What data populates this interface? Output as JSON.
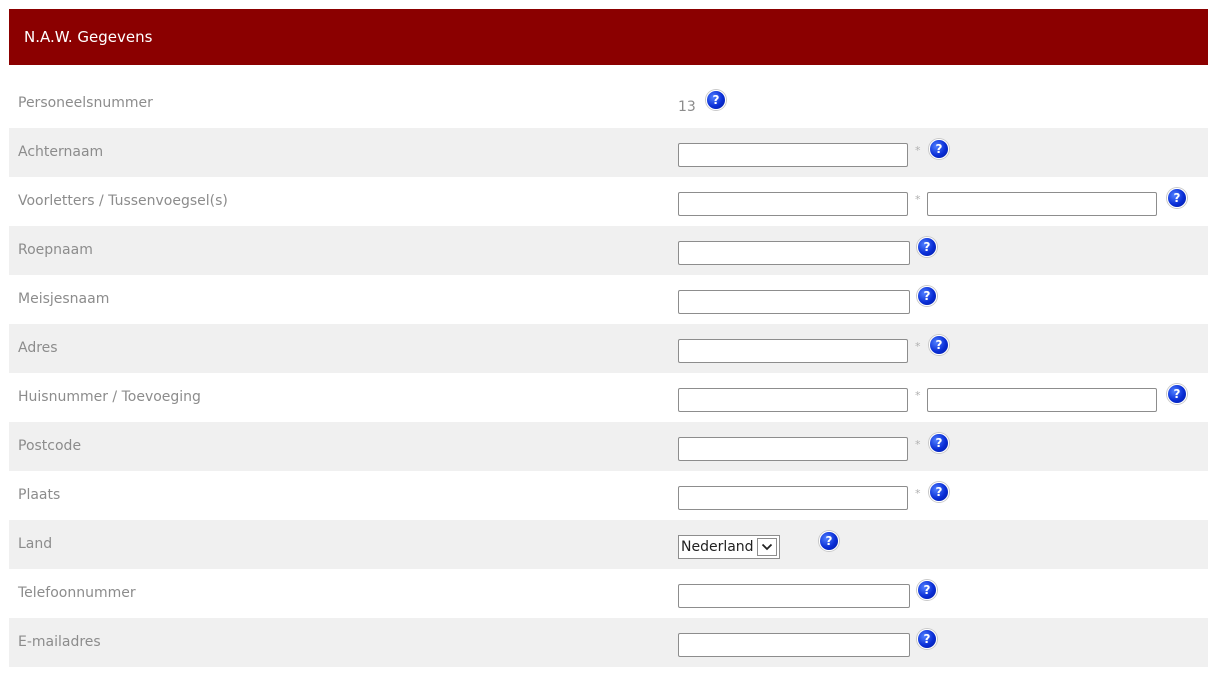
{
  "header": {
    "title": "N.A.W. Gegevens"
  },
  "colors": {
    "header_bg": "#8b0000",
    "help_icon": "#0a2ed6",
    "row_alt": "#f0f0f0"
  },
  "required_marker": "*",
  "help_glyph": "?",
  "fields": {
    "personeelsnummer": {
      "label": "Personeelsnummer",
      "value": "13"
    },
    "achternaam": {
      "label": "Achternaam",
      "value": ""
    },
    "voorletters_tussenvoegsels": {
      "label": "Voorletters / Tussenvoegsel(s)",
      "value1": "",
      "value2": ""
    },
    "roepnaam": {
      "label": "Roepnaam",
      "value": ""
    },
    "meisjesnaam": {
      "label": "Meisjesnaam",
      "value": ""
    },
    "adres": {
      "label": "Adres",
      "value": ""
    },
    "huisnummer_toevoeging": {
      "label": "Huisnummer / Toevoeging",
      "value1": "",
      "value2": ""
    },
    "postcode": {
      "label": "Postcode",
      "value": ""
    },
    "plaats": {
      "label": "Plaats",
      "value": ""
    },
    "land": {
      "label": "Land",
      "selected": "Nederland"
    },
    "telefoonnummer": {
      "label": "Telefoonnummer",
      "value": ""
    },
    "emailadres": {
      "label": "E-mailadres",
      "value": ""
    }
  }
}
